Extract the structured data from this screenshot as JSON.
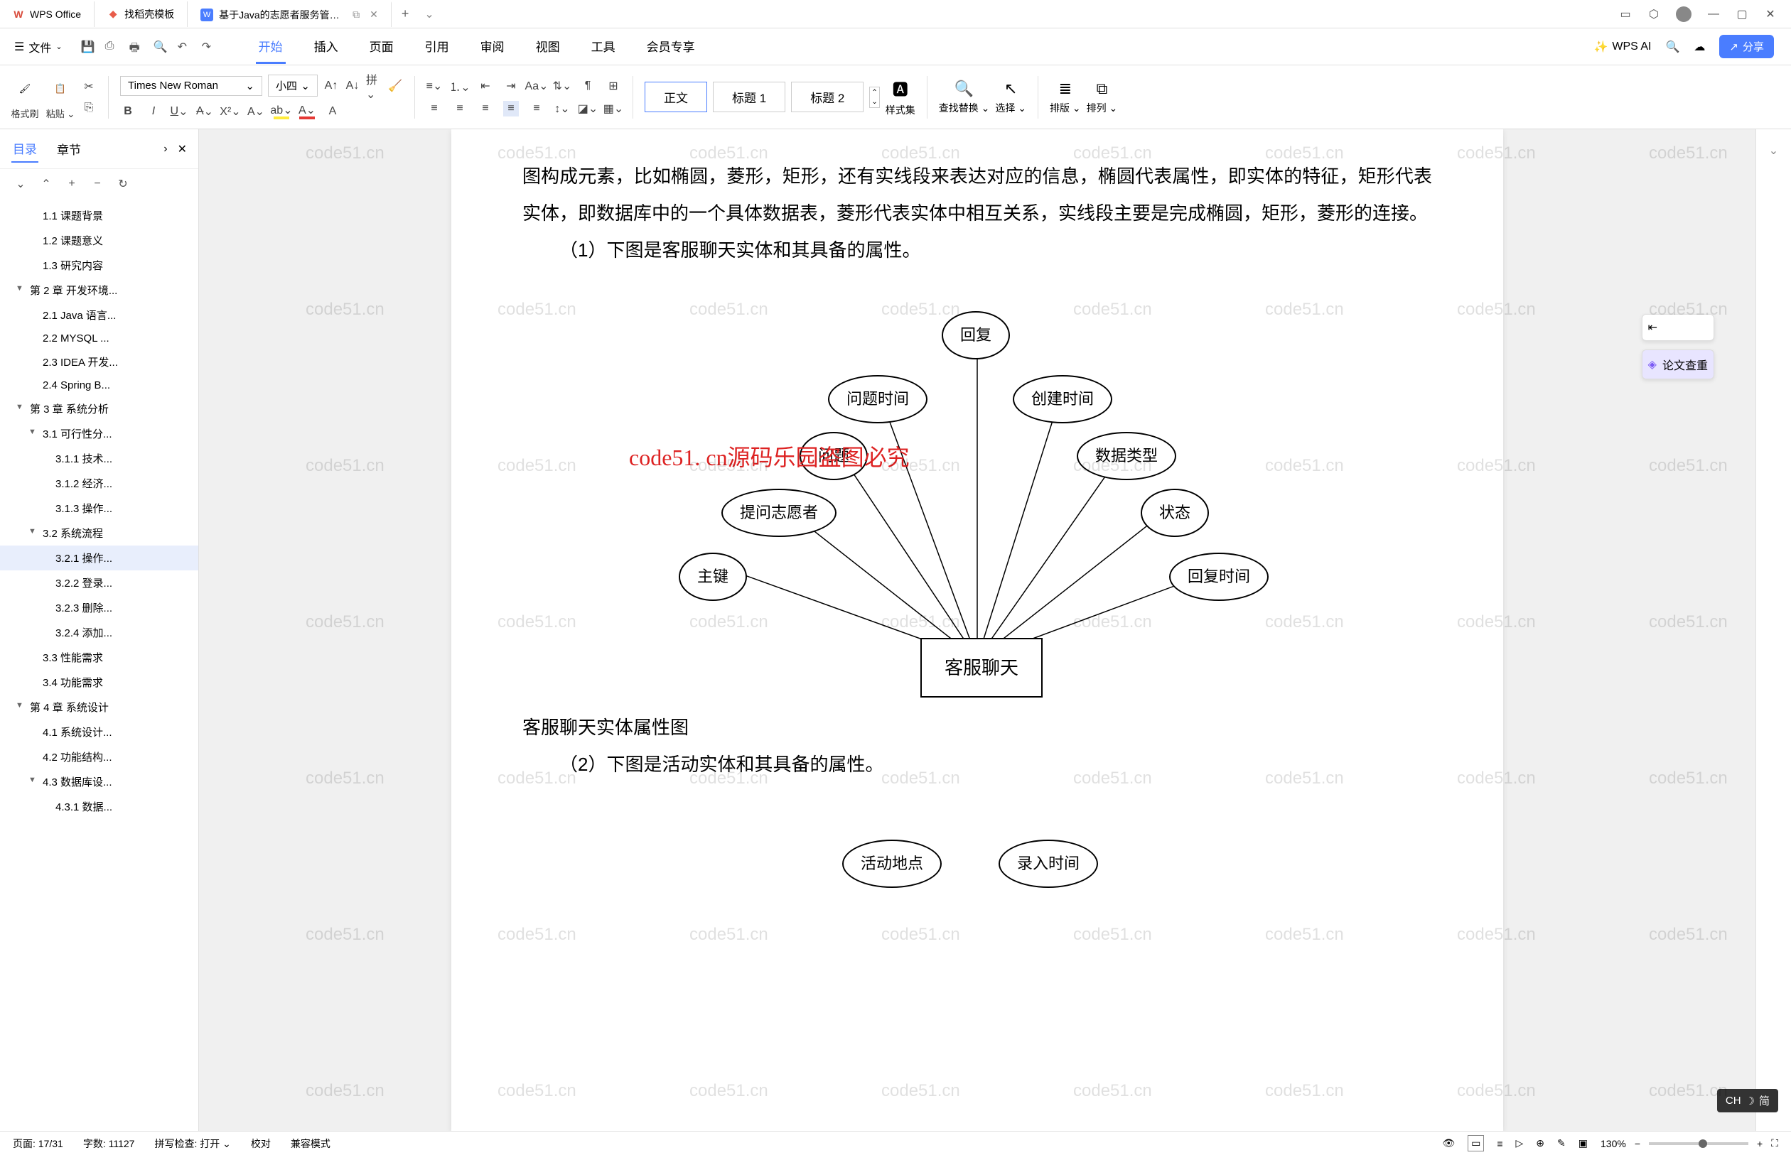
{
  "titlebar": {
    "app_name": "WPS Office",
    "tabs": [
      {
        "label": "找稻壳模板"
      },
      {
        "label": "基于Java的志愿者服务管理系统"
      }
    ],
    "add": "+"
  },
  "menubar": {
    "file": "文件",
    "items": [
      "开始",
      "插入",
      "页面",
      "引用",
      "审阅",
      "视图",
      "工具",
      "会员专享"
    ],
    "active_index": 0,
    "wps_ai": "WPS AI",
    "share": "分享"
  },
  "toolbar": {
    "format_brush": "格式刷",
    "paste": "粘贴",
    "font_name": "Times New Roman",
    "font_size": "小四",
    "styles": [
      "正文",
      "标题 1",
      "标题 2"
    ],
    "style_active": 0,
    "style_set": "样式集",
    "find_replace": "查找替换",
    "select": "选择",
    "layout": "排版",
    "arrange": "排列"
  },
  "sidebar": {
    "tabs": [
      "目录",
      "章节"
    ],
    "active_tab": 0,
    "outline": [
      {
        "label": "1.1 课题背景",
        "level": 2
      },
      {
        "label": "1.2 课题意义",
        "level": 2
      },
      {
        "label": "1.3 研究内容",
        "level": 2
      },
      {
        "label": "第 2 章 开发环境...",
        "level": 1,
        "caret": true
      },
      {
        "label": "2.1 Java 语言...",
        "level": 2
      },
      {
        "label": "2.2 MYSQL ...",
        "level": 2
      },
      {
        "label": "2.3 IDEA 开发...",
        "level": 2
      },
      {
        "label": "2.4 Spring B...",
        "level": 2
      },
      {
        "label": "第 3 章 系统分析",
        "level": 1,
        "caret": true
      },
      {
        "label": "3.1 可行性分...",
        "level": 2,
        "caret": true
      },
      {
        "label": "3.1.1 技术...",
        "level": 3
      },
      {
        "label": "3.1.2 经济...",
        "level": 3
      },
      {
        "label": "3.1.3 操作...",
        "level": 3
      },
      {
        "label": "3.2 系统流程",
        "level": 2,
        "caret": true
      },
      {
        "label": "3.2.1 操作...",
        "level": 3,
        "selected": true
      },
      {
        "label": "3.2.2 登录...",
        "level": 3
      },
      {
        "label": "3.2.3 删除...",
        "level": 3
      },
      {
        "label": "3.2.4 添加...",
        "level": 3
      },
      {
        "label": "3.3 性能需求",
        "level": 2
      },
      {
        "label": "3.4 功能需求",
        "level": 2
      },
      {
        "label": "第 4 章 系统设计",
        "level": 1,
        "caret": true
      },
      {
        "label": "4.1 系统设计...",
        "level": 2
      },
      {
        "label": "4.2 功能结构...",
        "level": 2
      },
      {
        "label": "4.3 数据库设...",
        "level": 2,
        "caret": true
      },
      {
        "label": "4.3.1 数据...",
        "level": 3
      }
    ]
  },
  "document": {
    "para1": "图构成元素，比如椭圆，菱形，矩形，还有实线段来表达对应的信息，椭圆代表属性，即实体的特征，矩形代表实体，即数据库中的一个具体数据表，菱形代表实体中相互关系，实线段主要是完成椭圆，矩形，菱形的连接。",
    "item1": "（1）下图是客服聊天实体和其具备的属性。",
    "diagram_caption": "客服聊天实体属性图",
    "item2": "（2）下图是活动实体和其具备的属性。",
    "er_entity": "客服聊天",
    "er_attrs": [
      "回复",
      "问题时间",
      "创建时间",
      "问题",
      "数据类型",
      "提问志愿者",
      "状态",
      "主键",
      "回复时间"
    ],
    "er2_attrs": [
      "活动地点",
      "录入时间"
    ],
    "watermark_text": "code51.cn",
    "watermark_red": "code51. cn源码乐园盗图必究"
  },
  "right_panel": {
    "review_btn": "论文查重"
  },
  "statusbar": {
    "page": "页面: 17/31",
    "words": "字数: 11127",
    "spell": "拼写检查: 打开",
    "proof": "校对",
    "compat": "兼容模式",
    "zoom": "130%"
  },
  "ime": {
    "lang": "CH",
    "mode": "简"
  }
}
